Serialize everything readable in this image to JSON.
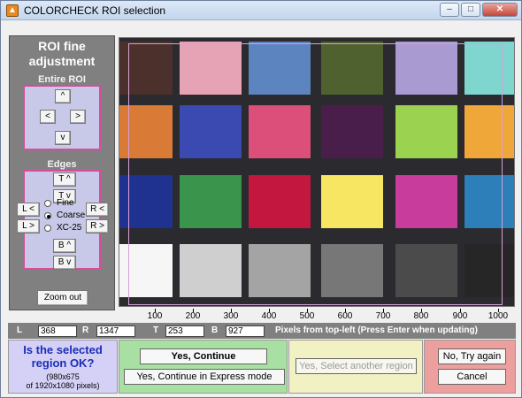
{
  "window": {
    "title": "COLORCHECK ROI selection",
    "icon": "matlab-icon",
    "controls": {
      "minimize": "–",
      "maximize": "□",
      "close": "✕"
    }
  },
  "left_panel": {
    "title_line1": "ROI fine",
    "title_line2": "adjustment",
    "entire_roi_label": "Entire ROI",
    "entire_roi_buttons": {
      "up": "^",
      "left": "<",
      "right": ">",
      "down": "v"
    },
    "edges_label": "Edges",
    "edge_buttons": {
      "top_up": "T ^",
      "top_down": "T v",
      "left_left": "L <",
      "left_right": "L >",
      "right_left": "R <",
      "right_right": "R >",
      "bottom_up": "B ^",
      "bottom_down": "B v"
    },
    "radio_options": [
      "Fine",
      "Coarse",
      "XC-25"
    ],
    "radio_selected": "Coarse",
    "zoom_out": "Zoom out"
  },
  "axis": {
    "ticks": [
      "100",
      "200",
      "300",
      "400",
      "500",
      "600",
      "700",
      "800",
      "900",
      "1000"
    ]
  },
  "coords": {
    "L_label": "L",
    "L_value": "368",
    "R_label": "R",
    "R_value": "1347",
    "T_label": "T",
    "T_value": "253",
    "B_label": "B",
    "B_value": "927",
    "note": "Pixels from top-left  (Press Enter when updating)"
  },
  "footer": {
    "question": "Is the selected region OK?",
    "size_line1": "(980x675",
    "size_line2": "of 1920x1080 pixels)",
    "yes_continue": "Yes, Continue",
    "yes_express": "Yes, Continue in Express mode",
    "yes_select_another": "Yes, Select another region",
    "no_try_again": "No, Try again",
    "cancel": "Cancel"
  },
  "colors": {
    "patch_colors": [
      "#4b302c",
      "#e7a3b6",
      "#5c84be",
      "#4f612f",
      "#a99ad2",
      "#7fd6cf",
      "#d97b36",
      "#3a4ab0",
      "#dc4f7b",
      "#4a1e4b",
      "#9bd350",
      "#f0a739",
      "#20328f",
      "#3b944c",
      "#c3173f",
      "#f6e661",
      "#c83d9b",
      "#2c7fb8",
      "#f6f6f6",
      "#cfcfcf",
      "#a4a4a4",
      "#777777",
      "#4b4b4b",
      "#262626"
    ]
  }
}
